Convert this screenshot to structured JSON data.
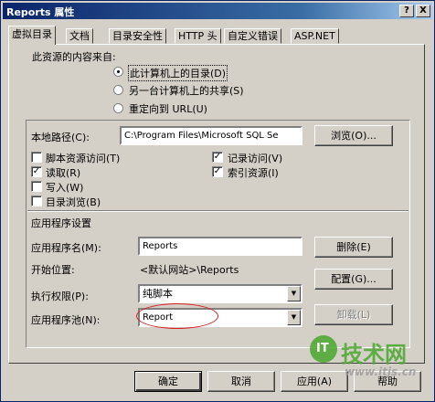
{
  "window": {
    "title": "Reports 属性",
    "help_glyph": "?",
    "close_glyph": "X"
  },
  "tabs": [
    {
      "label": "虚拟目录",
      "active": true
    },
    {
      "label": "文档"
    },
    {
      "label": "目录安全性"
    },
    {
      "label": "HTTP 头"
    },
    {
      "label": "自定义错误"
    },
    {
      "label": "ASP.NET"
    }
  ],
  "source": {
    "heading": "此资源的内容来自:",
    "options": [
      {
        "label": "此计算机上的目录(D)",
        "selected": true
      },
      {
        "label": "另一台计算机上的共享(S)",
        "selected": false
      },
      {
        "label": "重定向到 URL(U)",
        "selected": false
      }
    ]
  },
  "local_path": {
    "label": "本地路径(C):",
    "value": "C:\\Program Files\\Microsoft SQL Se",
    "browse_label": "浏览(O)..."
  },
  "checkboxes_left": [
    {
      "label": "脚本资源访问(T)",
      "checked": false
    },
    {
      "label": "读取(R)",
      "checked": true
    },
    {
      "label": "写入(W)",
      "checked": false
    },
    {
      "label": "目录浏览(B)",
      "checked": false
    }
  ],
  "checkboxes_right": [
    {
      "label": "记录访问(V)",
      "checked": true
    },
    {
      "label": "索引资源(I)",
      "checked": true
    }
  ],
  "app_settings": {
    "heading": "应用程序设置",
    "name_label": "应用程序名(M):",
    "name_value": "Reports",
    "remove_label": "删除(E)",
    "start_label": "开始位置:",
    "start_value": "<默认网站>\\Reports",
    "config_label": "配置(G)...",
    "perm_label": "执行权限(P):",
    "perm_value": "纯脚本",
    "pool_label": "应用程序池(N):",
    "pool_value": "Report",
    "unload_label": "卸载(L)"
  },
  "footer": {
    "ok": "确定",
    "cancel": "取消",
    "apply": "应用(A)",
    "help": "帮助"
  },
  "watermark": {
    "logo_text": "IT",
    "name": "技术网",
    "url": "www.itjs.cn"
  },
  "colors": {
    "title_start": "#0a246a",
    "title_end": "#a6caf0",
    "highlight_ellipse": "#d81e1e",
    "watermark": "#4aa82d",
    "face": "#d4d0c8"
  }
}
